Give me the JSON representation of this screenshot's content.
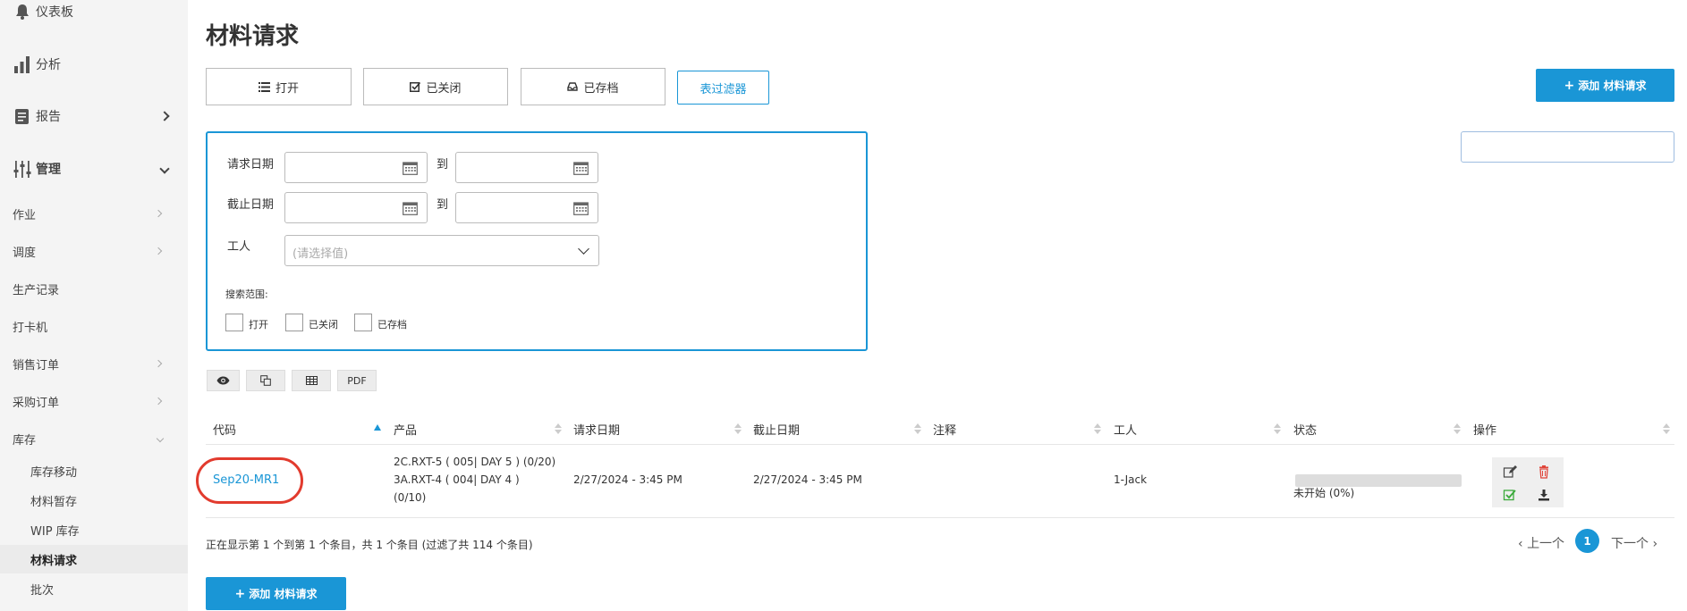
{
  "sidebar": {
    "main": [
      {
        "label": "仪表板",
        "icon": "bell-icon"
      },
      {
        "label": "分析",
        "icon": "bar-chart-icon"
      },
      {
        "label": "报告",
        "icon": "report-icon"
      },
      {
        "label": "管理",
        "icon": "sliders-icon"
      }
    ],
    "sub": [
      {
        "label": "作业"
      },
      {
        "label": "调度"
      },
      {
        "label": "生产记录"
      },
      {
        "label": "打卡机"
      },
      {
        "label": "销售订单"
      },
      {
        "label": "采购订单"
      },
      {
        "label": "库存"
      }
    ],
    "leaves": [
      {
        "label": "库存移动"
      },
      {
        "label": "材料暂存"
      },
      {
        "label": "WIP 库存"
      },
      {
        "label": "材料请求"
      },
      {
        "label": "批次"
      }
    ]
  },
  "page": {
    "title": "材料请求",
    "tabs": [
      {
        "label": "打开",
        "icon": "list-icon"
      },
      {
        "label": "已关闭",
        "icon": "check-square-icon"
      },
      {
        "label": "已存档",
        "icon": "inbox-icon"
      }
    ],
    "filter_button": "表过滤器",
    "add_button": "添加 材料请求",
    "add_button_bottom": "添加 材料请求"
  },
  "filters": {
    "request_date_label": "请求日期",
    "deadline_label": "截止日期",
    "to_label": "到",
    "worker_label": "工人",
    "worker_placeholder": "(请选择值)",
    "scope_label": "搜索范围:",
    "scope_options": [
      "打开",
      "已关闭",
      "已存档"
    ]
  },
  "tools": {
    "pdf": "PDF"
  },
  "table": {
    "headers": [
      "代码",
      "产品",
      "请求日期",
      "截止日期",
      "注释",
      "工人",
      "状态",
      "操作"
    ],
    "rows": [
      {
        "code": "Sep20-MR1",
        "product_line1": "2C.RXT-5 ( 005| DAY 5 ) (0/20)",
        "product_line2": "3A.RXT-4 ( 004| DAY 4 )",
        "product_line3": "(0/10)",
        "request_date": "2/27/2024 - 3:45 PM",
        "deadline": "2/27/2024 - 3:45 PM",
        "note": "",
        "worker": "1-Jack",
        "status": "未开始 (0%)",
        "progress": 0
      }
    ]
  },
  "footer": {
    "info": "正在显示第 1 个到第 1 个条目，共 1 个条目 (过滤了共 114 个条目)",
    "prev": "上一个",
    "current_page": "1",
    "next": "下一个"
  },
  "colors": {
    "accent": "#1a96d6",
    "highlight_circle": "#e23b2e"
  }
}
